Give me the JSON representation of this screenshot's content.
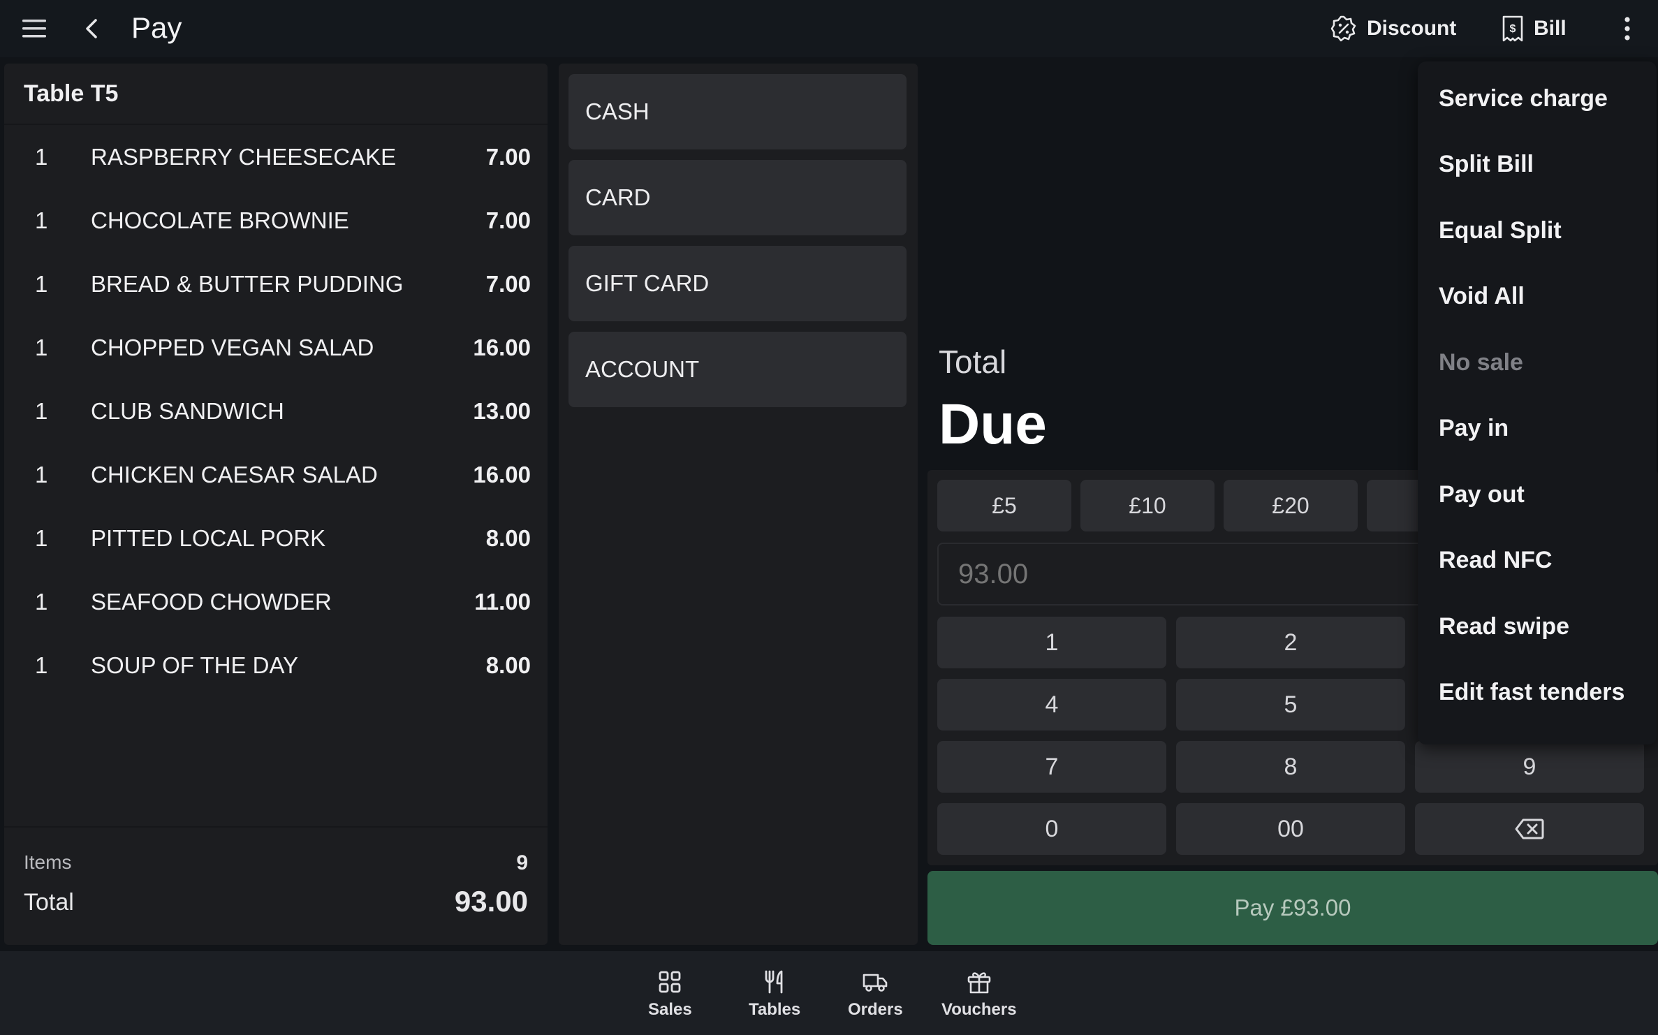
{
  "header": {
    "title": "Pay",
    "discount_label": "Discount",
    "bill_label": "Bill"
  },
  "order": {
    "table_name": "Table T5",
    "items": [
      {
        "qty": "1",
        "name": "RASPBERRY CHEESECAKE",
        "price": "7.00"
      },
      {
        "qty": "1",
        "name": "CHOCOLATE BROWNIE",
        "price": "7.00"
      },
      {
        "qty": "1",
        "name": "BREAD & BUTTER PUDDING",
        "price": "7.00"
      },
      {
        "qty": "1",
        "name": "CHOPPED VEGAN SALAD",
        "price": "16.00"
      },
      {
        "qty": "1",
        "name": "CLUB SANDWICH",
        "price": "13.00"
      },
      {
        "qty": "1",
        "name": "CHICKEN CAESAR SALAD",
        "price": "16.00"
      },
      {
        "qty": "1",
        "name": "PITTED LOCAL PORK",
        "price": "8.00"
      },
      {
        "qty": "1",
        "name": "SEAFOOD CHOWDER",
        "price": "11.00"
      },
      {
        "qty": "1",
        "name": "SOUP OF THE DAY",
        "price": "8.00"
      }
    ],
    "items_label": "Items",
    "items_count": "9",
    "total_label": "Total",
    "total_value": "93.00"
  },
  "tenders": [
    "CASH",
    "CARD",
    "GIFT CARD",
    "ACCOUNT"
  ],
  "payment": {
    "total_label": "Total",
    "due_label": "Due",
    "fast_tenders": [
      "£5",
      "£10",
      "£20"
    ],
    "amount_placeholder": "93.00",
    "keys": [
      "1",
      "2",
      "4",
      "5",
      "7",
      "8",
      "9",
      "0",
      "00"
    ],
    "pay_label": "Pay £93.00"
  },
  "menu": {
    "items": [
      {
        "label": "Service charge",
        "disabled": false
      },
      {
        "label": "Split Bill",
        "disabled": false
      },
      {
        "label": "Equal Split",
        "disabled": false
      },
      {
        "label": "Void All",
        "disabled": false
      },
      {
        "label": "No sale",
        "disabled": true
      },
      {
        "label": "Pay in",
        "disabled": false
      },
      {
        "label": "Pay out",
        "disabled": false
      },
      {
        "label": "Read NFC",
        "disabled": false
      },
      {
        "label": "Read swipe",
        "disabled": false
      },
      {
        "label": "Edit fast tenders",
        "disabled": false
      }
    ]
  },
  "nav": {
    "sales": "Sales",
    "tables": "Tables",
    "orders": "Orders",
    "vouchers": "Vouchers"
  },
  "colors": {
    "background": "#111418",
    "panel": "#1c1d20",
    "button": "#2c2d31",
    "pay_button": "#2d5e45"
  },
  "icons": [
    "menu-icon",
    "back-chevron-icon",
    "discount-icon",
    "bill-icon",
    "more-vertical-icon",
    "backspace-icon",
    "sales-grid-icon",
    "tables-cutlery-icon",
    "orders-truck-icon",
    "vouchers-gift-icon"
  ]
}
